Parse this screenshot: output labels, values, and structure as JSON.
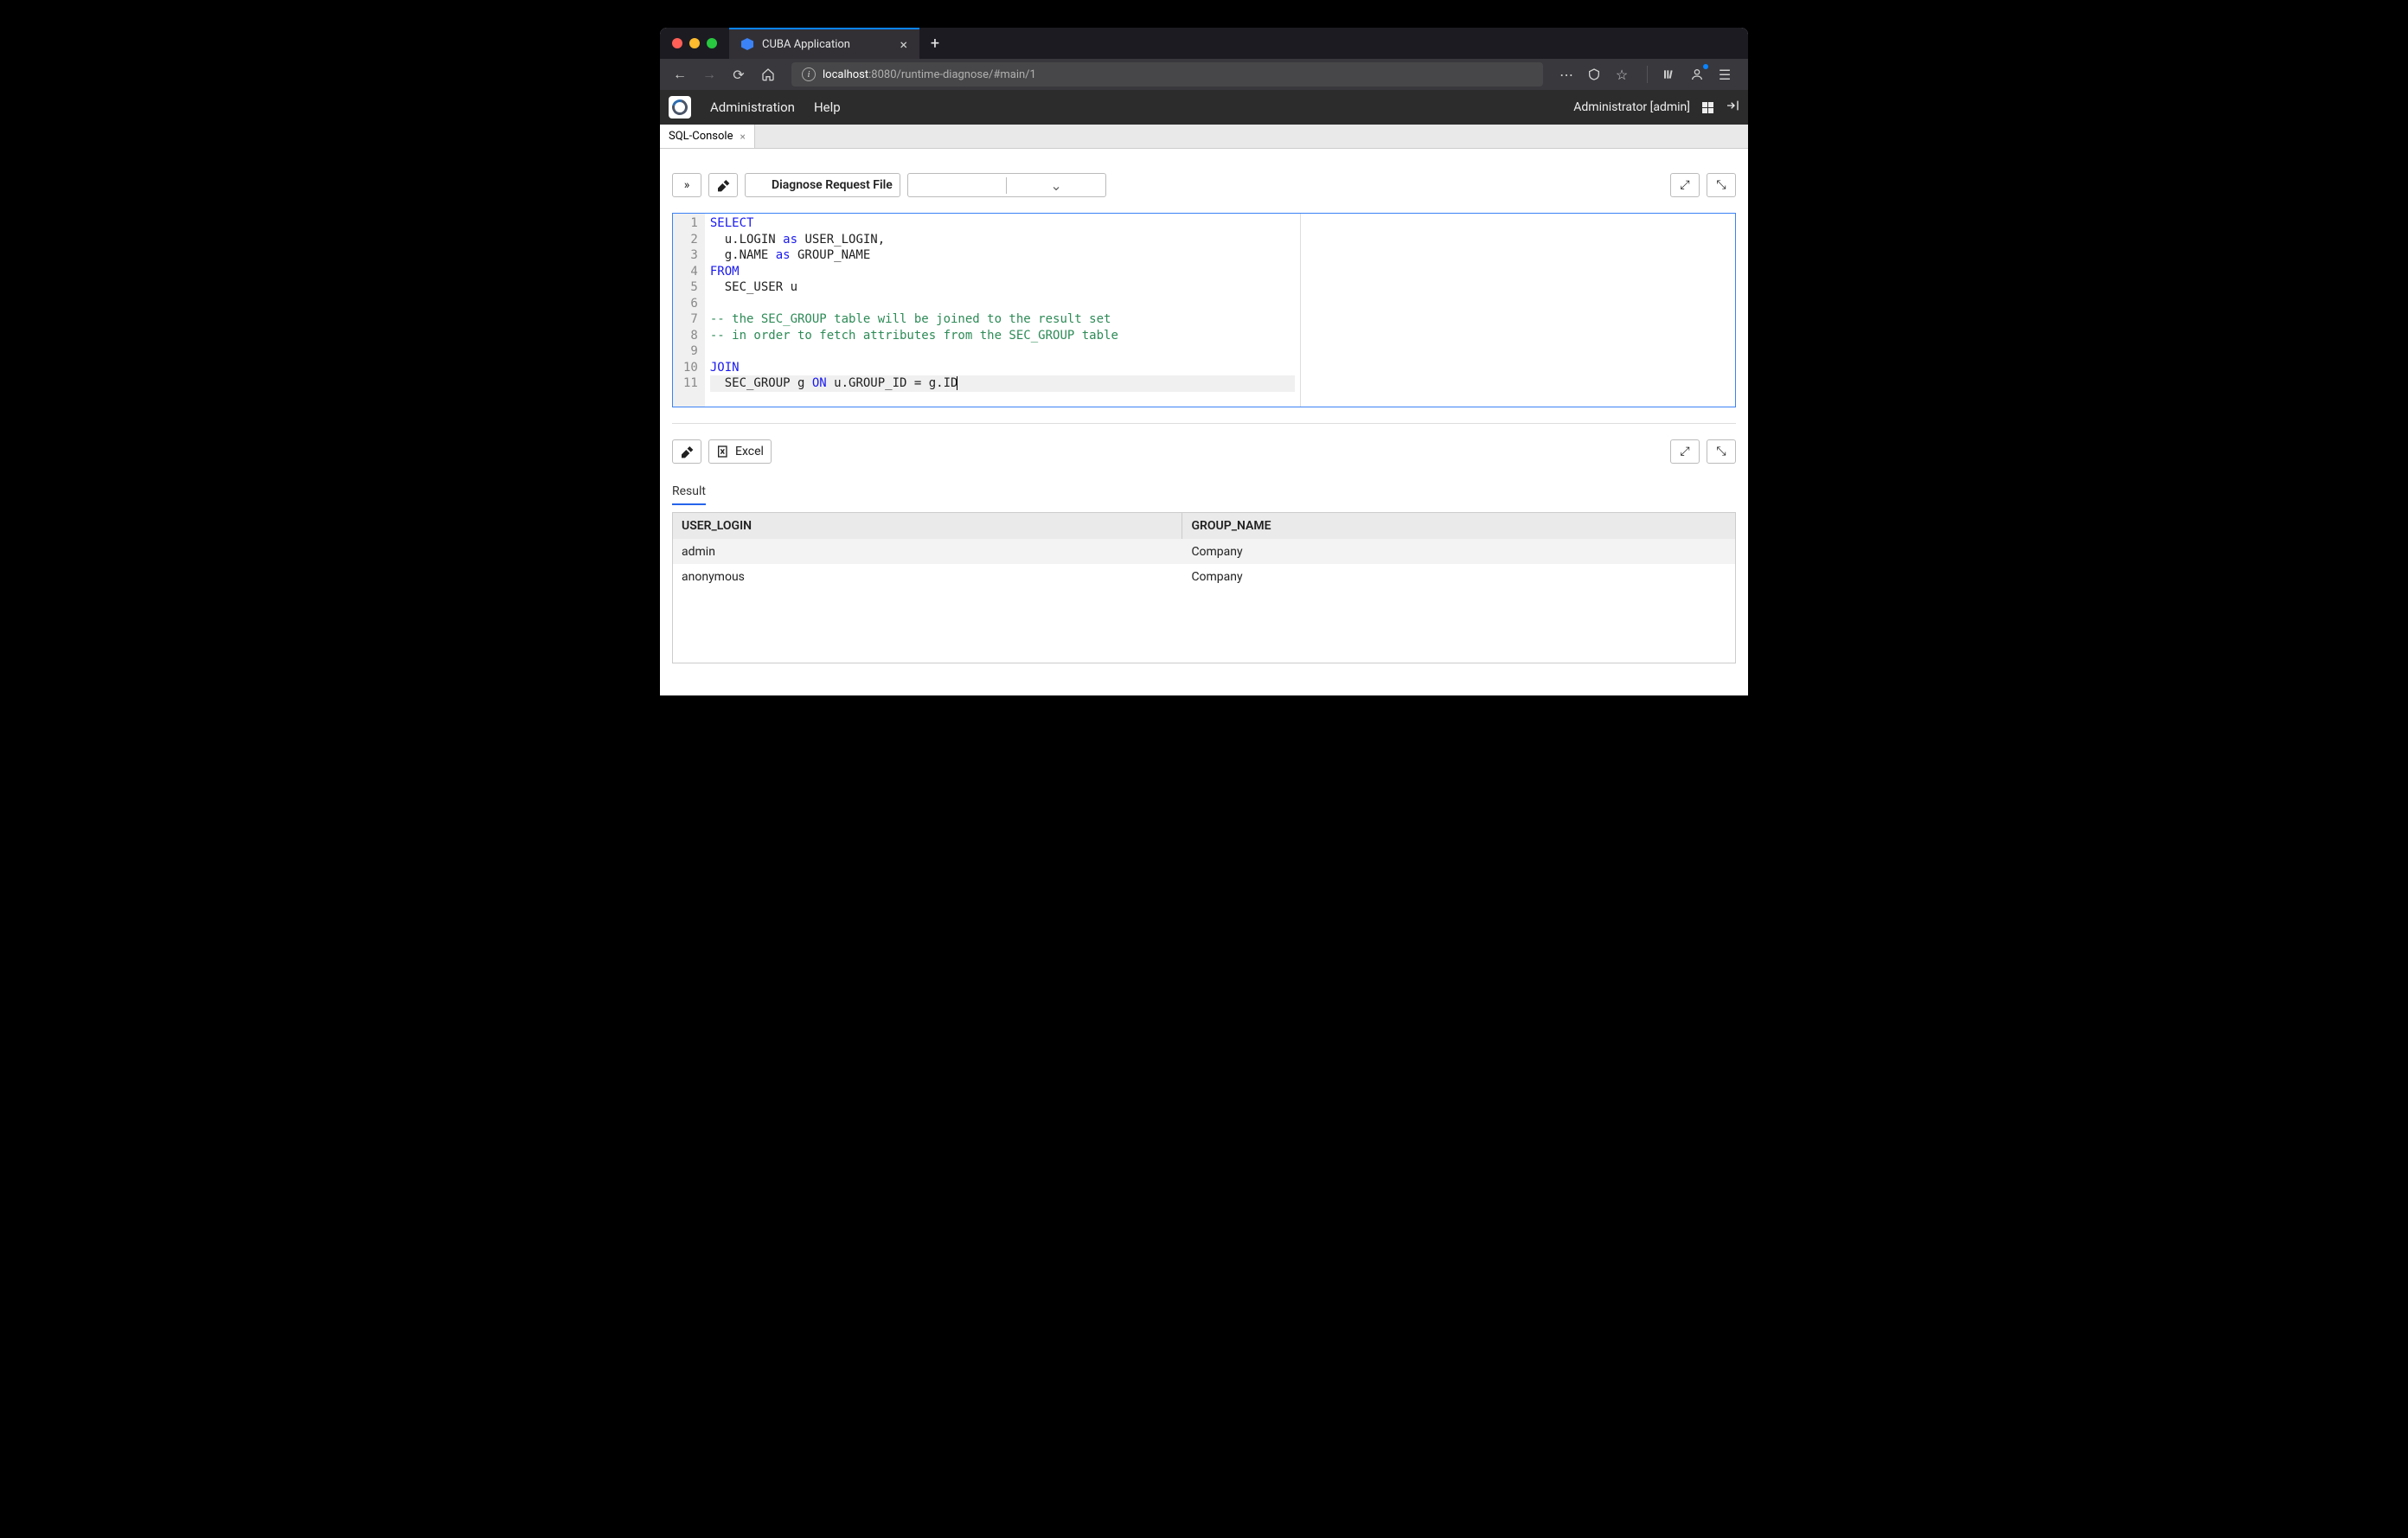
{
  "browser": {
    "tab_title": "CUBA Application",
    "url_host": "localhost",
    "url_port": ":8080",
    "url_path": "/runtime-diagnose/#main/1"
  },
  "appbar": {
    "menu1": "Administration",
    "menu2": "Help",
    "user": "Administrator [admin]"
  },
  "pagetab": {
    "label": "SQL-Console"
  },
  "toolbar": {
    "diagnose": "Diagnose Request File"
  },
  "editor_lines": [
    {
      "n": "1",
      "type": "code",
      "tokens": [
        {
          "t": "SELECT",
          "kw": true
        }
      ]
    },
    {
      "n": "2",
      "type": "code",
      "tokens": [
        {
          "t": "  u.LOGIN "
        },
        {
          "t": "as",
          "kw": true
        },
        {
          "t": " USER_LOGIN,"
        }
      ]
    },
    {
      "n": "3",
      "type": "code",
      "tokens": [
        {
          "t": "  g.NAME "
        },
        {
          "t": "as",
          "kw": true
        },
        {
          "t": " GROUP_NAME"
        }
      ]
    },
    {
      "n": "4",
      "type": "code",
      "tokens": [
        {
          "t": "FROM",
          "kw": true
        }
      ]
    },
    {
      "n": "5",
      "type": "code",
      "tokens": [
        {
          "t": "  SEC_USER u"
        }
      ]
    },
    {
      "n": "6",
      "type": "code",
      "tokens": []
    },
    {
      "n": "7",
      "type": "comment",
      "tokens": [
        {
          "t": "-- the SEC_GROUP table will be joined to the result set"
        }
      ]
    },
    {
      "n": "8",
      "type": "comment",
      "tokens": [
        {
          "t": "-- in order to fetch attributes from the SEC_GROUP table"
        }
      ]
    },
    {
      "n": "9",
      "type": "code",
      "tokens": []
    },
    {
      "n": "10",
      "type": "code",
      "tokens": [
        {
          "t": "JOIN",
          "kw": true
        }
      ]
    },
    {
      "n": "11",
      "type": "code",
      "cur": true,
      "tokens": [
        {
          "t": "  SEC_GROUP g "
        },
        {
          "t": "ON",
          "kw": true
        },
        {
          "t": " u.GROUP_ID = g.ID"
        }
      ]
    }
  ],
  "results": {
    "excel": "Excel",
    "tab": "Result",
    "columns": [
      "USER_LOGIN",
      "GROUP_NAME"
    ],
    "rows": [
      [
        "admin",
        "Company"
      ],
      [
        "anonymous",
        "Company"
      ]
    ]
  }
}
